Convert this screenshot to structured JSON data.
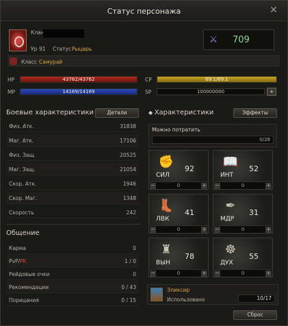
{
  "window": {
    "title": "Статус персонажа",
    "close_glyph": "✕"
  },
  "profile": {
    "clan_label": "Клан",
    "level_label": "Ур",
    "level": "91",
    "status_label": "Статус",
    "status": "Рыцарь",
    "class_label": "Класс",
    "class_value": "Самурай",
    "combat_power": "709",
    "combat_power_icon": "crossed-swords-icon"
  },
  "bars": {
    "hp": {
      "label": "HP",
      "text": "43762/43762",
      "fill": 1.0,
      "color": "#b02a22"
    },
    "mp": {
      "label": "MP",
      "text": "14169/14169",
      "fill": 1.0,
      "color": "#2a4db8"
    },
    "cp": {
      "label": "CP",
      "text": "69.1/69.1",
      "fill": 1.0,
      "color": "#c8a224"
    },
    "sp": {
      "label": "SP",
      "text": "100000000",
      "button": "+"
    }
  },
  "combat": {
    "title": "Боевые характеристики",
    "details_button": "Детали",
    "rows": [
      {
        "k": "Физ. Атк.",
        "v": "31838"
      },
      {
        "k": "Маг. Атк.",
        "v": "17106"
      },
      {
        "k": "Физ. Защ.",
        "v": "20525"
      },
      {
        "k": "Маг. Защ.",
        "v": "21054"
      },
      {
        "k": "Скор. Атк.",
        "v": "1946"
      },
      {
        "k": "Скор. Маг.",
        "v": "1348"
      },
      {
        "k": "Скорость",
        "v": "242"
      }
    ]
  },
  "social": {
    "title": "Общение",
    "rows": [
      {
        "k": "Карма",
        "v": "0"
      },
      {
        "k_a": "PvP/",
        "k_b": "PK",
        "v": "1 / 0"
      },
      {
        "k": "Рейдовые очки",
        "v": "0"
      },
      {
        "k": "Рекомендации",
        "v": "0 / 43"
      },
      {
        "k": "Порицания",
        "v": "0 / 15"
      }
    ]
  },
  "stats": {
    "title": "Характеристики",
    "effects_button": "Эффекты",
    "spend_label": "Можно потратить",
    "spend_value": "0/28",
    "items": [
      {
        "name": "СИЛ",
        "value": "92",
        "alloc": "0",
        "icon": "fist-icon"
      },
      {
        "name": "ИНТ",
        "value": "52",
        "alloc": "0",
        "icon": "book-icon"
      },
      {
        "name": "ЛВК",
        "value": "41",
        "alloc": "0",
        "icon": "boot-icon"
      },
      {
        "name": "МДР",
        "value": "31",
        "alloc": "0",
        "icon": "quill-icon"
      },
      {
        "name": "ВЫН",
        "value": "78",
        "alloc": "0",
        "icon": "armor-icon"
      },
      {
        "name": "ДУХ",
        "value": "55",
        "alloc": "0",
        "icon": "spirit-icon"
      }
    ],
    "minus": "−",
    "plus": "+"
  },
  "elixir": {
    "name": "Эликсир",
    "used_label": "Использовано",
    "count": "10/17"
  },
  "reset_button": "Сброс"
}
